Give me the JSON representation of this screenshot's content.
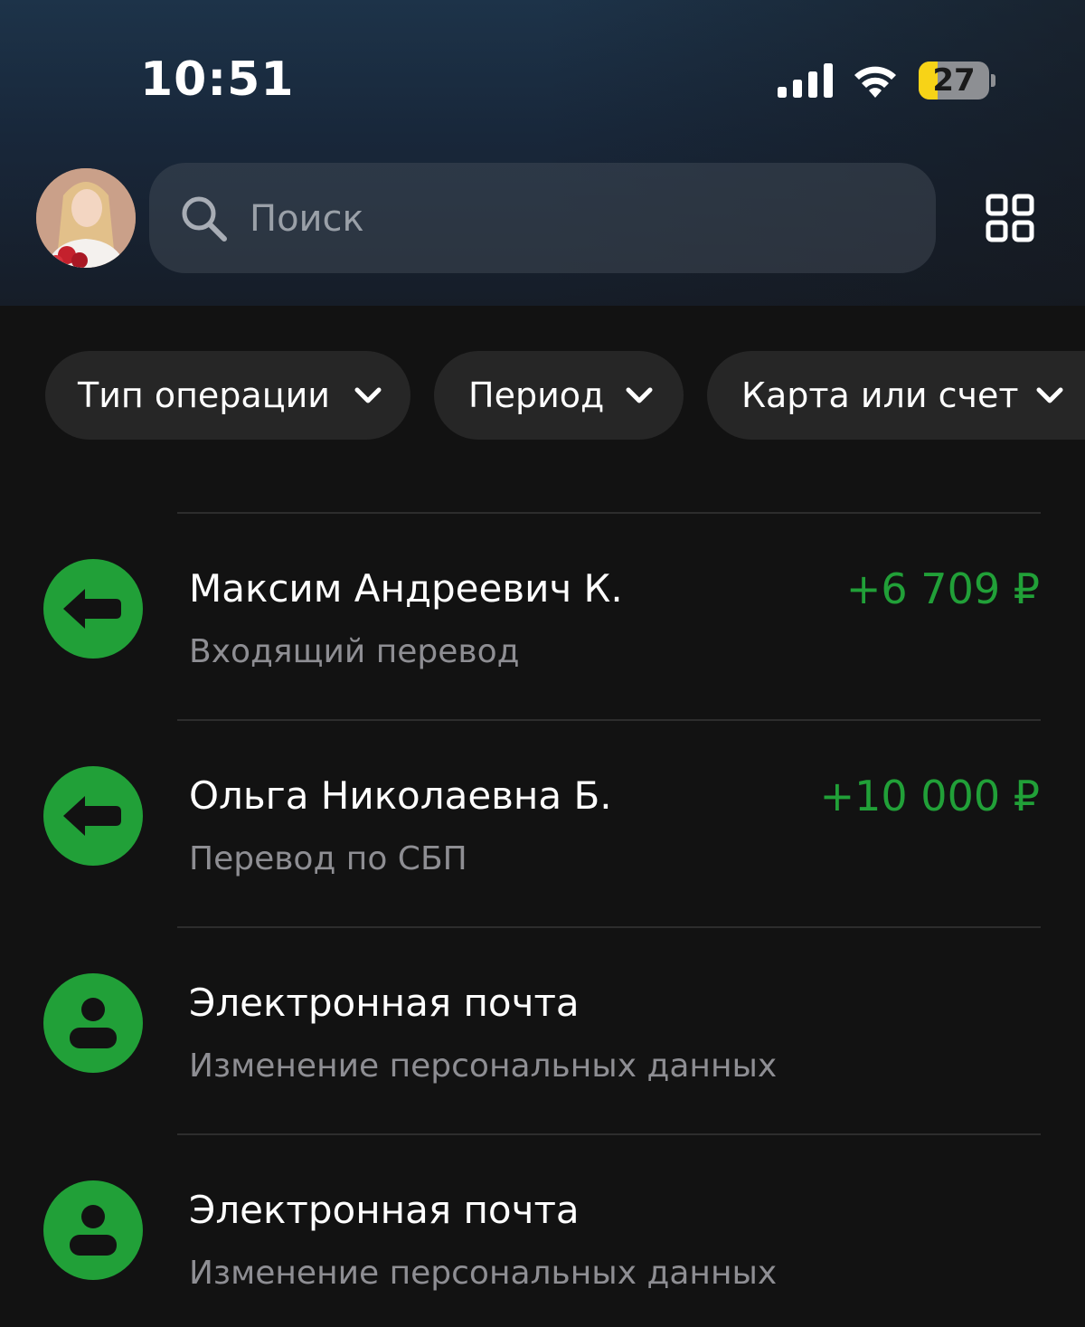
{
  "status_bar": {
    "time": "10:51",
    "battery_level": "27",
    "battery_fraction": 0.27,
    "signal_icon": "cellular-signal-icon",
    "wifi_icon": "wifi-icon"
  },
  "header": {
    "avatar_icon": "user-avatar",
    "search": {
      "placeholder": "Поиск",
      "icon": "search-icon"
    },
    "apps_icon": "grid-icon"
  },
  "filters": [
    {
      "label": "Тип операции",
      "icon": "chevron-down-icon"
    },
    {
      "label": "Период",
      "icon": "chevron-down-icon"
    },
    {
      "label": "Карта или счет",
      "icon": "chevron-down-icon"
    }
  ],
  "operations": [
    {
      "title": "Максим Андреевич К.",
      "subtitle": "Входящий перевод",
      "amount": "+6 709 ₽",
      "icon": "incoming-arrow-icon"
    },
    {
      "title": "Ольга Николаевна Б.",
      "subtitle": "Перевод по СБП",
      "amount": "+10 000 ₽",
      "icon": "incoming-arrow-icon"
    },
    {
      "title": "Электронная почта",
      "subtitle": "Изменение персональных данных",
      "amount": "",
      "icon": "person-icon"
    },
    {
      "title": "Электронная почта",
      "subtitle": "Изменение персональных данных",
      "amount": "",
      "icon": "person-icon"
    }
  ],
  "colors": {
    "accent_green": "#21a038",
    "background": "#121212",
    "chip_background": "#262626",
    "secondary_text": "#8e8e93",
    "battery_yellow": "#f7d317"
  }
}
